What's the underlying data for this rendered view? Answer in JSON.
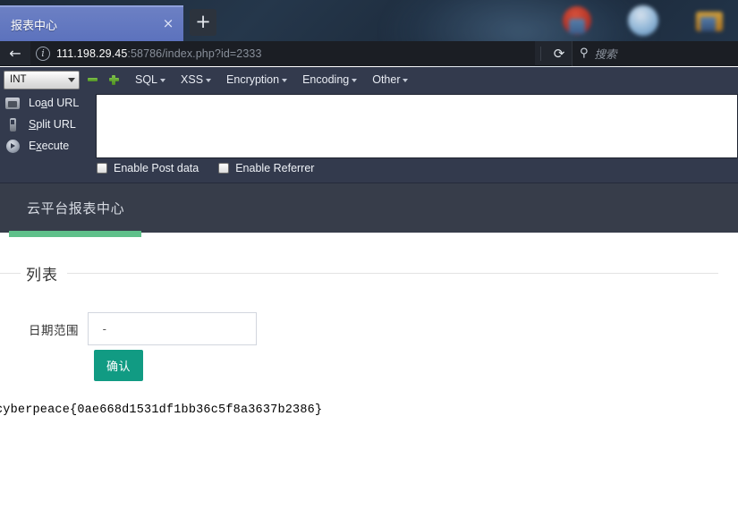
{
  "desktop": {
    "icons": [
      {
        "name": "firefox-desktop-icon"
      },
      {
        "name": "water-desktop-icon"
      },
      {
        "name": "folder-desktop-icon"
      }
    ]
  },
  "browser": {
    "tab": {
      "title": "报表中心",
      "close_label": "×"
    },
    "new_tab_label": "+",
    "nav": {
      "back_label": "←",
      "info_label": "i",
      "reload_label": "⟳",
      "url_host": "111.198.29.45",
      "url_rest": ":58786/index.php?id=2333"
    },
    "search": {
      "icon_label": "⚲",
      "placeholder": "搜索"
    }
  },
  "hackbar": {
    "type_select": {
      "value": "INT"
    },
    "icon_buttons": [
      {
        "name": "remove-row-icon"
      },
      {
        "name": "add-row-icon"
      }
    ],
    "menus": [
      {
        "label": "SQL"
      },
      {
        "label": "XSS"
      },
      {
        "label": "Encryption"
      },
      {
        "label": "Encoding"
      },
      {
        "label": "Other"
      }
    ],
    "actions": [
      {
        "label_pre": "Lo",
        "label_key": "a",
        "label_post": "d URL"
      },
      {
        "label_pre": "",
        "label_key": "S",
        "label_post": "plit URL"
      },
      {
        "label_pre": "E",
        "label_key": "x",
        "label_post": "ecute"
      }
    ],
    "url_textarea": {
      "value": "",
      "placeholder": ""
    },
    "checkboxes": [
      {
        "label": "Enable Post data",
        "checked": false
      },
      {
        "label": "Enable Referrer",
        "checked": false
      }
    ]
  },
  "page": {
    "brand": "云平台报表中心",
    "section_title": "列表",
    "form": {
      "date_label": "日期范围",
      "date_value": " - ",
      "date_placeholder": " - ",
      "submit_label": "确认"
    },
    "flag": "cyberpeace{0ae668d1531df1bb36c5f8a3637b2386}"
  },
  "colors": {
    "accent_green": "#5fc08a",
    "button_teal": "#119b83",
    "header_dark": "#373d4a",
    "tab_blue": "#5c72bd",
    "hackbar_bg": "#333a4d"
  }
}
